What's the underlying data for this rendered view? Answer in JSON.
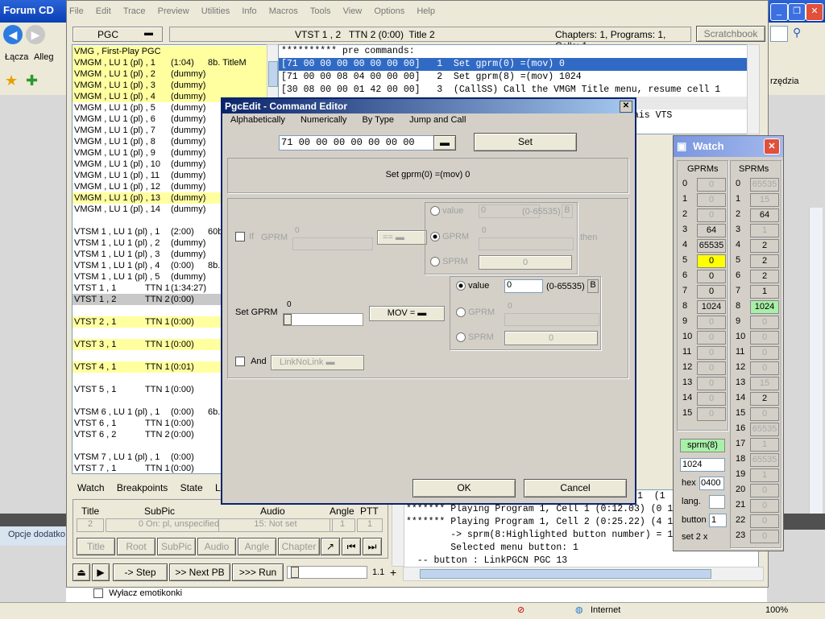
{
  "browser": {
    "title": "Forum CD",
    "links_label": "Łącza",
    "links_item": "Alleg",
    "right_toolbar_text": "rzędzia",
    "left_sidebar_text": "Opcje dodatko",
    "checkbox_label": "Wyłacz emotikonki",
    "status_zone": "Internet",
    "zoom": "100%"
  },
  "app": {
    "menu": [
      "File",
      "Edit",
      "Trace",
      "Preview",
      "Utilities",
      "Info",
      "Macros",
      "Tools",
      "View",
      "Options",
      "Help"
    ],
    "pgc_combo": "PGC",
    "current_title": "VTST 1 , 2   TTN 2 (0:00)  Title 2",
    "chapters_info": "Chapters: 1, Programs: 1, Cells: 1",
    "scratchbook": "Scratchbook",
    "pgc_list": [
      {
        "name": "VMG , First-Play PGC",
        "c2": "",
        "c3": "",
        "c4": "",
        "hl": "yl"
      },
      {
        "name": "VMGM , LU 1 (pl) , 1",
        "c2": "",
        "c3": "(1:04)",
        "c4": "8b.  TitleM",
        "hl": "yl"
      },
      {
        "name": "VMGM , LU 1 (pl) , 2",
        "c2": "",
        "c3": "(dummy)",
        "c4": "",
        "hl": "yl"
      },
      {
        "name": "VMGM , LU 1 (pl) , 3",
        "c2": "",
        "c3": "(dummy)",
        "c4": "",
        "hl": "yl"
      },
      {
        "name": "VMGM , LU 1 (pl) , 4",
        "c2": "",
        "c3": "(dummy)",
        "c4": "",
        "hl": "yl"
      },
      {
        "name": "VMGM , LU 1 (pl) , 5",
        "c2": "",
        "c3": "(dummy)",
        "c4": "",
        "hl": ""
      },
      {
        "name": "VMGM , LU 1 (pl) , 6",
        "c2": "",
        "c3": "(dummy)",
        "c4": "",
        "hl": ""
      },
      {
        "name": "VMGM , LU 1 (pl) , 7",
        "c2": "",
        "c3": "(dummy)",
        "c4": "",
        "hl": ""
      },
      {
        "name": "VMGM , LU 1 (pl) , 8",
        "c2": "",
        "c3": "(dummy)",
        "c4": "",
        "hl": ""
      },
      {
        "name": "VMGM , LU 1 (pl) , 9",
        "c2": "",
        "c3": "(dummy)",
        "c4": "",
        "hl": ""
      },
      {
        "name": "VMGM , LU 1 (pl) , 10",
        "c2": "",
        "c3": "(dummy)",
        "c4": "",
        "hl": ""
      },
      {
        "name": "VMGM , LU 1 (pl) , 11",
        "c2": "",
        "c3": "(dummy)",
        "c4": "",
        "hl": ""
      },
      {
        "name": "VMGM , LU 1 (pl) , 12",
        "c2": "",
        "c3": "(dummy)",
        "c4": "",
        "hl": ""
      },
      {
        "name": "VMGM , LU 1 (pl) , 13",
        "c2": "",
        "c3": "(dummy)",
        "c4": "",
        "hl": "yl"
      },
      {
        "name": "VMGM , LU 1 (pl) , 14",
        "c2": "",
        "c3": "(dummy)",
        "c4": "",
        "hl": ""
      },
      {
        "name": "",
        "c2": "",
        "c3": "",
        "c4": "",
        "hl": ""
      },
      {
        "name": "VTSM 1 , LU 1 (pl) , 1",
        "c2": "",
        "c3": "(2:00)",
        "c4": "60b",
        "hl": ""
      },
      {
        "name": "VTSM 1 , LU 1 (pl) , 2",
        "c2": "",
        "c3": "(dummy)",
        "c4": "",
        "hl": ""
      },
      {
        "name": "VTSM 1 , LU 1 (pl) , 3",
        "c2": "",
        "c3": "(dummy)",
        "c4": "",
        "hl": ""
      },
      {
        "name": "VTSM 1 , LU 1 (pl) , 4",
        "c2": "",
        "c3": "(0:00)",
        "c4": "8b.",
        "hl": ""
      },
      {
        "name": "VTSM 1 , LU 1 (pl) , 5",
        "c2": "",
        "c3": "(dummy)",
        "c4": "",
        "hl": ""
      },
      {
        "name": "VTST 1 , 1",
        "c2": "TTN 1",
        "c3": "(1:34:27)",
        "c4": "",
        "hl": ""
      },
      {
        "name": "VTST 1 , 2",
        "c2": "TTN 2",
        "c3": "(0:00)",
        "c4": "",
        "hl": "gr"
      },
      {
        "name": "",
        "c2": "",
        "c3": "",
        "c4": "",
        "hl": ""
      },
      {
        "name": "VTST 2 , 1",
        "c2": "TTN 1",
        "c3": "(0:00)",
        "c4": "",
        "hl": "yl"
      },
      {
        "name": "",
        "c2": "",
        "c3": "",
        "c4": "",
        "hl": ""
      },
      {
        "name": "VTST 3 , 1",
        "c2": "TTN 1",
        "c3": "(0:00)",
        "c4": "",
        "hl": "yl"
      },
      {
        "name": "",
        "c2": "",
        "c3": "",
        "c4": "",
        "hl": ""
      },
      {
        "name": "VTST 4 , 1",
        "c2": "TTN 1",
        "c3": "(0:01)",
        "c4": "",
        "hl": "yl"
      },
      {
        "name": "",
        "c2": "",
        "c3": "",
        "c4": "",
        "hl": ""
      },
      {
        "name": "VTST 5 , 1",
        "c2": "TTN 1",
        "c3": "(0:00)",
        "c4": "",
        "hl": ""
      },
      {
        "name": "",
        "c2": "",
        "c3": "",
        "c4": "",
        "hl": ""
      },
      {
        "name": "VTSM 6 , LU 1 (pl) , 1",
        "c2": "",
        "c3": "(0:00)",
        "c4": "6b.",
        "hl": ""
      },
      {
        "name": "VTST 6 , 1",
        "c2": "TTN 1",
        "c3": "(0:00)",
        "c4": "",
        "hl": ""
      },
      {
        "name": "VTST 6 , 2",
        "c2": "TTN 2",
        "c3": "(0:00)",
        "c4": "",
        "hl": ""
      },
      {
        "name": "",
        "c2": "",
        "c3": "",
        "c4": "",
        "hl": ""
      },
      {
        "name": "VTSM 7 , LU 1 (pl) , 1",
        "c2": "",
        "c3": "(0:00)",
        "c4": "",
        "hl": ""
      },
      {
        "name": "VTST 7 , 1",
        "c2": "TTN 1",
        "c3": "(0:00)",
        "c4": "",
        "hl": ""
      }
    ],
    "commands_header": "********** pre commands:",
    "commands": [
      "[71 00 00 00 00 00 00 00]   1  Set gprm(0) =(mov) 0",
      "[71 00 00 08 04 00 00 00]   2  Set gprm(8) =(mov) 1024",
      "[30 08 00 00 01 42 00 00]   3  (CallSS) Call the VMGM Title menu, resume cell 1"
    ],
    "cmd_right_fragment": "ais VTS",
    "cmd_lower_fragment": "1  (1",
    "bottom_tabs": [
      "Watch",
      "Breakpoints",
      "State",
      "Log"
    ],
    "status_headers": {
      "title": "Title",
      "subpic": "SubPic",
      "audio": "Audio",
      "angle": "Angle",
      "ptt": "PTT"
    },
    "status_values": {
      "title": "2",
      "subpic": "0 On: pl, unspecified",
      "audio": "15: Not set",
      "angle": "1",
      "ptt": "1"
    },
    "nav_buttons": [
      "Title",
      "Root",
      "SubPic",
      "Audio",
      "Angle",
      "Chapter"
    ],
    "play_buttons": {
      "step": "-> Step",
      "next": ">> Next PB",
      "run": ">>> Run"
    },
    "speed": "1.1",
    "log_lines": [
      "******* Playing Program 1, Cell 1 (0:12.03) (0 1",
      "******* Playing Program 1, Cell 2 (0:25.22) (4 1",
      "        -> sprm(8:Highlighted button number) = 1",
      "        Selected menu button: 1",
      "  -- button : LinkPGCN PGC 13"
    ]
  },
  "dialog": {
    "title": "PgcEdit - Command Editor",
    "menu": [
      "Alphabetically",
      "Numerically",
      "By Type",
      "Jump and Call"
    ],
    "hex_value": "71 00 00 00 00 00 00 00",
    "set_button": "Set",
    "description": "Set gprm(0) =(mov) 0",
    "if_label": "If",
    "gprm_label": "GPRM",
    "gprm_zero": "0",
    "op_value": "==",
    "value_label": "value",
    "value_field": "0",
    "value_range": "(0-65535)",
    "b_label": "B",
    "sprm_label": "SPRM",
    "sprm_value": "0",
    "then_label": "then",
    "set_gprm_label": "Set GPRM",
    "set_gprm_num": "0",
    "mov_value": "MOV  =",
    "and_label": "And",
    "link_value": "LinkNoLink",
    "ok": "OK",
    "cancel": "Cancel"
  },
  "watch": {
    "title": "Watch",
    "gprm_header": "GPRMs",
    "sprm_header": "SPRMs",
    "gprm": [
      {
        "i": "0",
        "v": "0",
        "s": "dis"
      },
      {
        "i": "1",
        "v": "0",
        "s": "dis"
      },
      {
        "i": "2",
        "v": "0",
        "s": "dis"
      },
      {
        "i": "3",
        "v": "64",
        "s": ""
      },
      {
        "i": "4",
        "v": "65535",
        "s": ""
      },
      {
        "i": "5",
        "v": "0",
        "s": "yel"
      },
      {
        "i": "6",
        "v": "0",
        "s": ""
      },
      {
        "i": "7",
        "v": "0",
        "s": ""
      },
      {
        "i": "8",
        "v": "1024",
        "s": ""
      },
      {
        "i": "9",
        "v": "0",
        "s": "dis"
      },
      {
        "i": "10",
        "v": "0",
        "s": "dis"
      },
      {
        "i": "11",
        "v": "0",
        "s": "dis"
      },
      {
        "i": "12",
        "v": "0",
        "s": "dis"
      },
      {
        "i": "13",
        "v": "0",
        "s": "dis"
      },
      {
        "i": "14",
        "v": "0",
        "s": "dis"
      },
      {
        "i": "15",
        "v": "0",
        "s": "dis"
      }
    ],
    "sprm": [
      {
        "i": "0",
        "v": "65535",
        "s": "dis"
      },
      {
        "i": "1",
        "v": "15",
        "s": "dis"
      },
      {
        "i": "2",
        "v": "64",
        "s": ""
      },
      {
        "i": "3",
        "v": "1",
        "s": "dis"
      },
      {
        "i": "4",
        "v": "2",
        "s": ""
      },
      {
        "i": "5",
        "v": "2",
        "s": ""
      },
      {
        "i": "6",
        "v": "2",
        "s": ""
      },
      {
        "i": "7",
        "v": "1",
        "s": ""
      },
      {
        "i": "8",
        "v": "1024",
        "s": "grn"
      },
      {
        "i": "9",
        "v": "0",
        "s": "dis"
      },
      {
        "i": "10",
        "v": "0",
        "s": "dis"
      },
      {
        "i": "11",
        "v": "0",
        "s": "dis"
      },
      {
        "i": "12",
        "v": "0",
        "s": "dis"
      },
      {
        "i": "13",
        "v": "15",
        "s": "dis"
      },
      {
        "i": "14",
        "v": "2",
        "s": ""
      },
      {
        "i": "15",
        "v": "0",
        "s": "dis"
      },
      {
        "i": "16",
        "v": "65535",
        "s": "dis"
      },
      {
        "i": "17",
        "v": "1",
        "s": "dis"
      },
      {
        "i": "18",
        "v": "65535",
        "s": "dis"
      },
      {
        "i": "19",
        "v": "1",
        "s": "dis"
      },
      {
        "i": "20",
        "v": "0",
        "s": "dis"
      },
      {
        "i": "21",
        "v": "0",
        "s": "dis"
      },
      {
        "i": "22",
        "v": "0",
        "s": "dis"
      },
      {
        "i": "23",
        "v": "0",
        "s": "dis"
      }
    ],
    "selected_reg": "sprm(8)",
    "selected_val": "1024",
    "hex_label": "hex",
    "hex_val": "0400",
    "lang_label": "lang.",
    "button_label": "button",
    "button_val": "1",
    "set_label": "set 2 x"
  },
  "colors": {
    "highlight": "#ffffa0",
    "selected": "#316ac5",
    "titlebar": "#0a246a"
  }
}
